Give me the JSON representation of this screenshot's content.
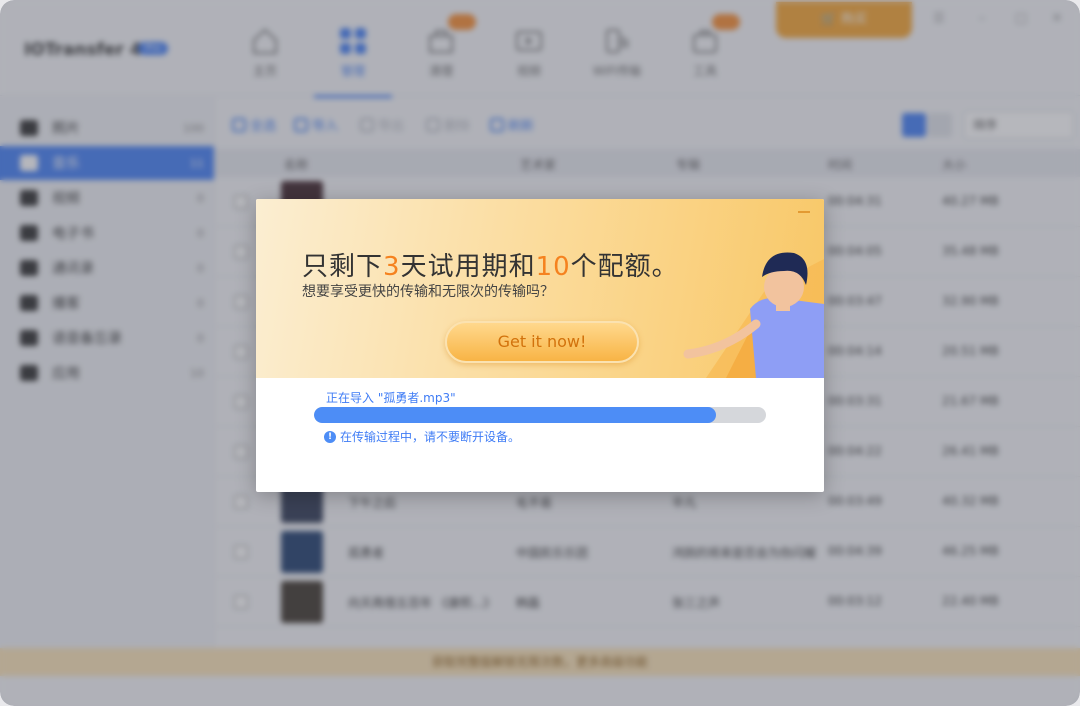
{
  "app": {
    "title": "IOTransfer 4",
    "badge": "Pro",
    "buy_label": "购买"
  },
  "nav": [
    {
      "label": "主页",
      "icon": "home-icon"
    },
    {
      "label": "管理",
      "icon": "manage-icon",
      "active": true
    },
    {
      "label": "清理",
      "icon": "clean-icon",
      "badge": true
    },
    {
      "label": "视频",
      "icon": "video-icon"
    },
    {
      "label": "WiFi传输",
      "icon": "wifi-transfer-icon"
    },
    {
      "label": "工具",
      "icon": "tools-icon",
      "badge": true
    }
  ],
  "sidebar": {
    "items": [
      {
        "label": "照片",
        "count": "100"
      },
      {
        "label": "音乐",
        "count": "11",
        "active": true
      },
      {
        "label": "视频",
        "count": "0"
      },
      {
        "label": "电子书",
        "count": "0"
      },
      {
        "label": "通讯录",
        "count": "0"
      },
      {
        "label": "播客",
        "count": "0"
      },
      {
        "label": "语音备忘录",
        "count": "0"
      },
      {
        "label": "应用",
        "count": "10"
      }
    ]
  },
  "toolbar": {
    "select": "全选",
    "import": "导入",
    "export": "导出",
    "delete": "删除",
    "refresh": "刷新",
    "sort": "排序"
  },
  "table": {
    "headers": [
      "名称",
      "艺术家",
      "专辑",
      "时间",
      "大小"
    ],
    "rows": [
      {
        "name": "",
        "artist": "",
        "album": "",
        "time": "00:04:31",
        "size": "40.27 MB"
      },
      {
        "name": "",
        "artist": "",
        "album": "",
        "time": "00:04:05",
        "size": "35.48 MB"
      },
      {
        "name": "",
        "artist": "",
        "album": "",
        "time": "00:03:47",
        "size": "32.90 MB"
      },
      {
        "name": "",
        "artist": "",
        "album": "",
        "time": "00:04:14",
        "size": "20.51 MB"
      },
      {
        "name": "",
        "artist": "",
        "album": "",
        "time": "00:03:31",
        "size": "21.67 MB"
      },
      {
        "name": "",
        "artist": "",
        "album": "",
        "time": "00:04:22",
        "size": "26.41 MB"
      },
      {
        "name": "下午之后",
        "artist": "毛不易",
        "album": "平凡",
        "time": "00:03:49",
        "size": "40.32 MB"
      },
      {
        "name": "孤勇者",
        "artist": "中国民乐乐团",
        "album": "鸿鹄的将来是否会为你闪耀",
        "time": "00:04:39",
        "size": "46.25 MB"
      },
      {
        "name": "向天再借五百年 《康熙...》",
        "artist": "韩磊",
        "album": "张三之声",
        "time": "00:03:12",
        "size": "22.40 MB"
      }
    ]
  },
  "bottom_bar": "获取完整版解锁无限次数，更多高级功能",
  "dialog": {
    "title_prefix": "只剩下",
    "title_days": "3",
    "title_mid": "天试用期和",
    "title_quota": "10",
    "title_suffix": "个配额。",
    "subtitle": "想要享受更快的传输和无限次的传输吗？",
    "cta": "Get it now!",
    "progress_label": "正在导入 \"孤勇者.mp3\"",
    "progress": 0.89,
    "warning": "在传输过程中，请不要断开设备。"
  },
  "colors": {
    "accent": "#3f7cf5",
    "promo_orange": "#f5821f"
  }
}
